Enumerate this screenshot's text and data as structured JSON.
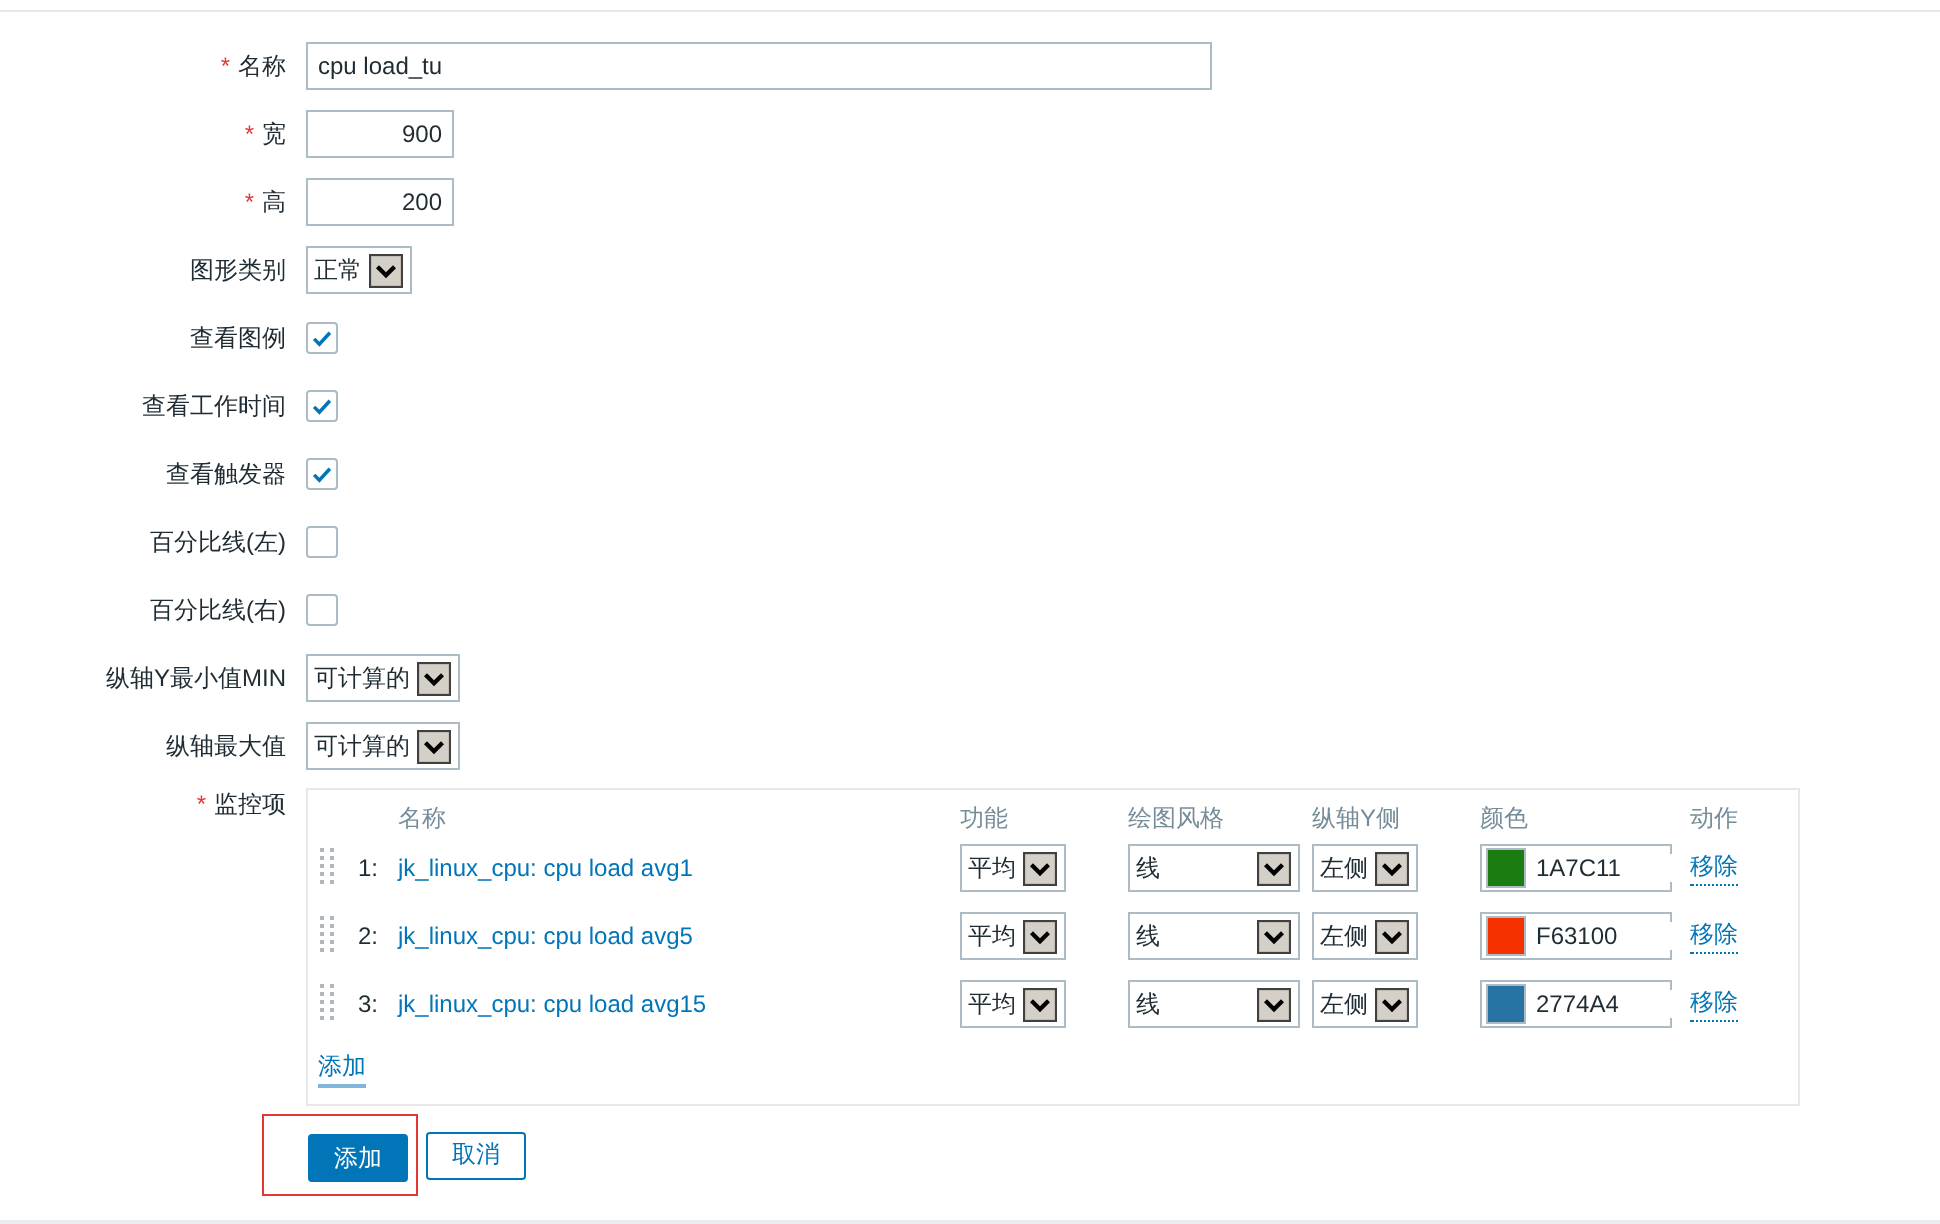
{
  "form": {
    "fields": [
      {
        "kind": "text",
        "label": "名称",
        "required_mark": "*",
        "value": "cpu load_tu"
      },
      {
        "kind": "number",
        "label": "宽",
        "required_mark": "*",
        "value": "900"
      },
      {
        "kind": "number",
        "label": "高",
        "required_mark": "*",
        "value": "200"
      },
      {
        "kind": "select",
        "label": "图形类别",
        "value": "正常"
      },
      {
        "kind": "checkbox",
        "label": "查看图例",
        "checked": true
      },
      {
        "kind": "checkbox",
        "label": "查看工作时间",
        "checked": true
      },
      {
        "kind": "checkbox",
        "label": "查看触发器",
        "checked": true
      },
      {
        "kind": "checkbox",
        "label": "百分比线(左)",
        "checked": false
      },
      {
        "kind": "checkbox",
        "label": "百分比线(右)",
        "checked": false
      },
      {
        "kind": "select",
        "label": "纵轴Y最小值MIN",
        "value": "可计算的"
      },
      {
        "kind": "select",
        "label": "纵轴最大值",
        "value": "可计算的"
      }
    ],
    "items": {
      "label": "监控项",
      "required_mark": "*",
      "columns": [
        "名称",
        "功能",
        "绘图风格",
        "纵轴Y侧",
        "颜色",
        "动作"
      ],
      "rows": [
        {
          "number": "1:",
          "name": "jk_linux_cpu: cpu load avg1",
          "function": "平均",
          "style": "线",
          "axis": "左侧",
          "color": "#1a7c11",
          "color_code": "1A7C11",
          "action": "移除"
        },
        {
          "number": "2:",
          "name": "jk_linux_cpu: cpu load avg5",
          "function": "平均",
          "style": "线",
          "axis": "左侧",
          "color": "#f63100",
          "color_code": "F63100",
          "action": "移除"
        },
        {
          "number": "3:",
          "name": "jk_linux_cpu: cpu load avg15",
          "function": "平均",
          "style": "线",
          "axis": "左侧",
          "color": "#2774a4",
          "color_code": "2774A4",
          "action": "移除"
        }
      ],
      "add_link": "添加"
    }
  },
  "buttons": [
    {
      "kind": "primary",
      "label": "添加",
      "highlighted": true
    },
    {
      "kind": "secondary",
      "label": "取消",
      "highlighted": false
    }
  ]
}
